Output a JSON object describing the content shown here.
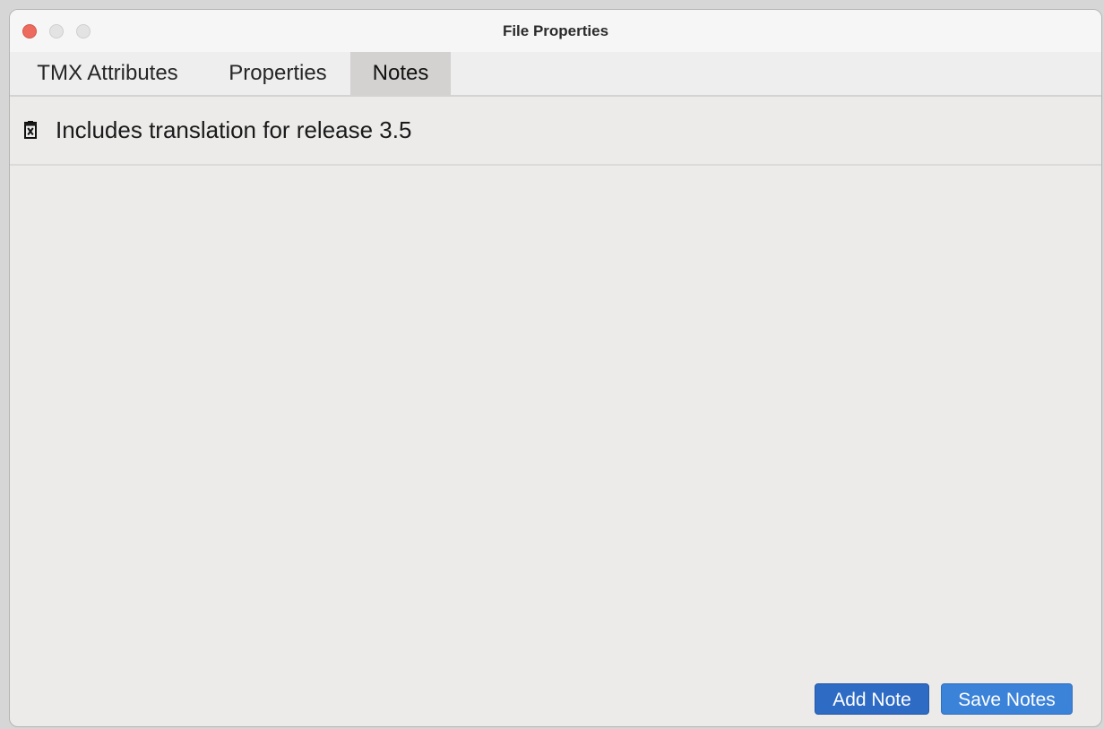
{
  "window": {
    "title": "File Properties"
  },
  "tabs": [
    {
      "label": "TMX Attributes",
      "selected": false
    },
    {
      "label": "Properties",
      "selected": false
    },
    {
      "label": "Notes",
      "selected": true
    }
  ],
  "notes": [
    {
      "text": "Includes translation for release 3.5",
      "icon": "delete-note-icon"
    }
  ],
  "buttons": {
    "add_note": "Add Note",
    "save_notes": "Save Notes"
  },
  "colors": {
    "close_button": "#ed6a5e",
    "primary_button": "#2e6bc5",
    "secondary_button": "#3b82d9",
    "selected_tab": "#d3d2d1"
  }
}
